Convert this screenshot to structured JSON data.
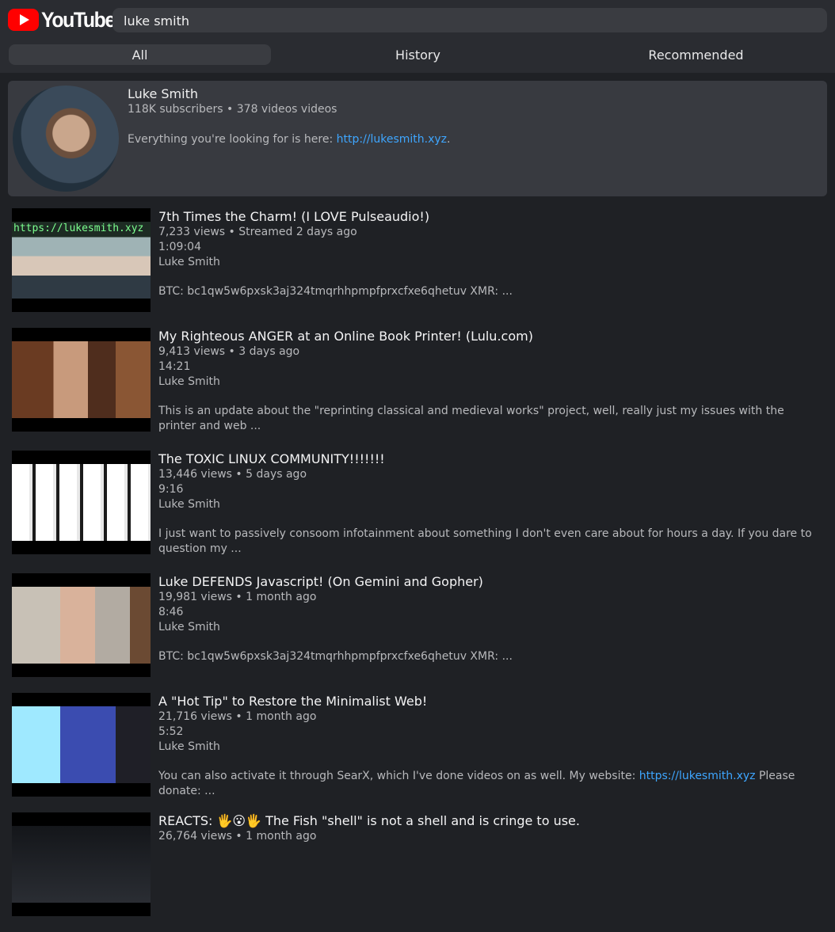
{
  "app": {
    "logo_text": "YouTube"
  },
  "search": {
    "value": "luke smith"
  },
  "tabs": [
    {
      "label": "All",
      "active": true
    },
    {
      "label": "History",
      "active": false
    },
    {
      "label": "Recommended",
      "active": false
    }
  ],
  "channel": {
    "name": "Luke Smith",
    "meta": "118K subscribers • 378 videos videos",
    "desc_prefix": "Everything you're looking for is here: ",
    "desc_link": "http://lukesmith.xyz",
    "desc_suffix": "."
  },
  "videos": [
    {
      "title": "7th Times the Charm! (I LOVE Pulseaudio!)",
      "meta": "7,233 views • Streamed 2 days ago",
      "duration": "1:09:04",
      "channel": "Luke Smith",
      "description": "BTC: bc1qw5w6pxsk3aj324tmqrhhpmpfprxcfxe6qhetuv XMR: ...",
      "thumb_text": "https://lukesmith.xyz"
    },
    {
      "title": "My Righteous ANGER at an Online Book Printer! (Lulu.com)",
      "meta": "9,413 views • 3 days ago",
      "duration": "14:21",
      "channel": "Luke Smith",
      "description": "This is an update about the \"reprinting classical and medieval works\" project, well, really just my issues with the printer and web ..."
    },
    {
      "title": "The TOXIC LINUX COMMUNITY!!!!!!!",
      "meta": "13,446 views • 5 days ago",
      "duration": "9:16",
      "channel": "Luke Smith",
      "description": "I just want to passively consoom infotainment about something I don't even care about for hours a day. If you dare to question my ..."
    },
    {
      "title": "Luke DEFENDS Javascript! (On Gemini and Gopher)",
      "meta": "19,981 views • 1 month ago",
      "duration": "8:46",
      "channel": "Luke Smith",
      "description": "BTC: bc1qw5w6pxsk3aj324tmqrhhpmpfprxcfxe6qhetuv XMR: ..."
    },
    {
      "title": "A \"Hot Tip\" to Restore the Minimalist Web!",
      "meta": "21,716 views • 1 month ago",
      "duration": "5:52",
      "channel": "Luke Smith",
      "description_prefix": "You can also activate it through SearX, which I've done videos on as well. My website: ",
      "description_link": "https://lukesmith.xyz",
      "description_suffix": " Please donate: ..."
    },
    {
      "title": "REACTS: 🖐️😮🖐️ The Fish \"shell\" is not a shell and is cringe to use.",
      "meta": "26,764 views • 1 month ago"
    }
  ],
  "colors": {
    "background": "#1f2125",
    "topbar": "#2a2c31",
    "link": "#3ea6ff",
    "logo_red": "#ff0000"
  }
}
